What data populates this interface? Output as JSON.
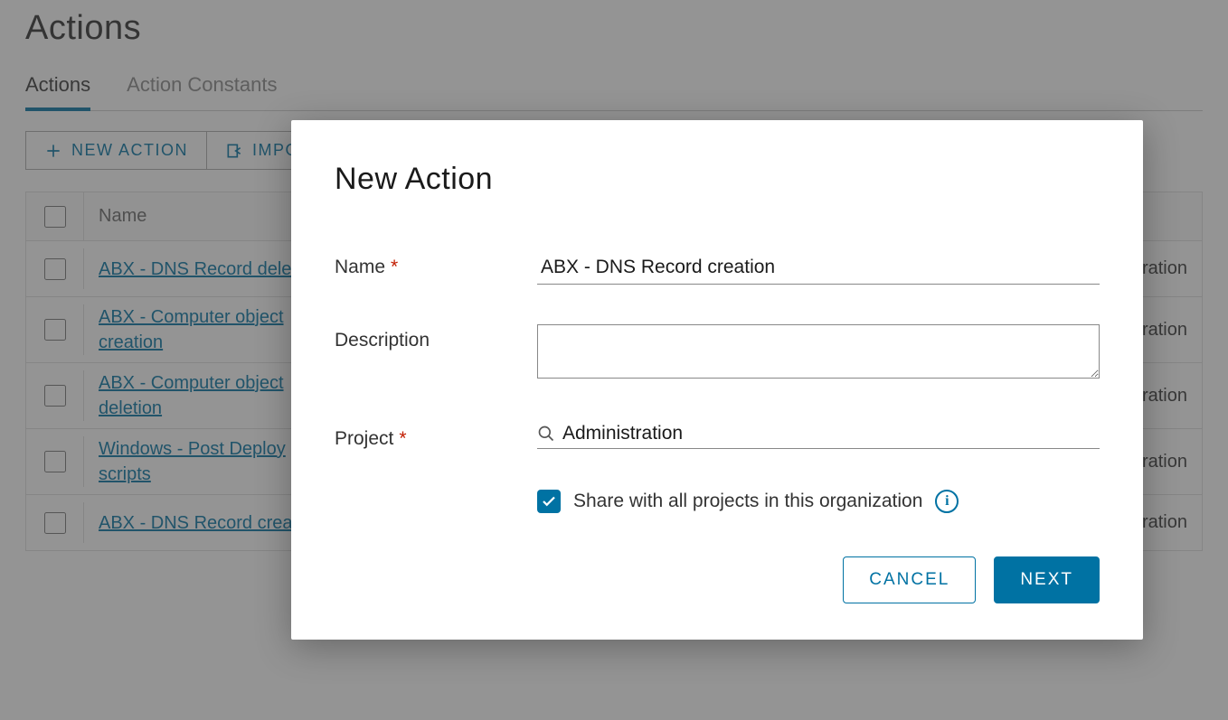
{
  "page": {
    "title": "Actions",
    "tabs": [
      "Actions",
      "Action Constants"
    ],
    "active_tab": 0,
    "toolbar": {
      "new_action": "NEW ACTION",
      "import": "IMPORT"
    },
    "table": {
      "header_name": "Name",
      "right_col_fragment": "nistration",
      "rows": [
        {
          "name": "ABX - DNS Record deletion"
        },
        {
          "name": "ABX - Computer object creation"
        },
        {
          "name": "ABX - Computer object deletion"
        },
        {
          "name": "Windows - Post Deploy scripts"
        },
        {
          "name": "ABX - DNS Record creation"
        }
      ]
    }
  },
  "modal": {
    "title": "New Action",
    "labels": {
      "name": "Name",
      "description": "Description",
      "project": "Project",
      "share": "Share with all projects in this organization"
    },
    "values": {
      "name": "ABX - DNS Record creation",
      "description": "",
      "project": "Administration",
      "share_checked": true
    },
    "buttons": {
      "cancel": "CANCEL",
      "next": "NEXT"
    }
  }
}
